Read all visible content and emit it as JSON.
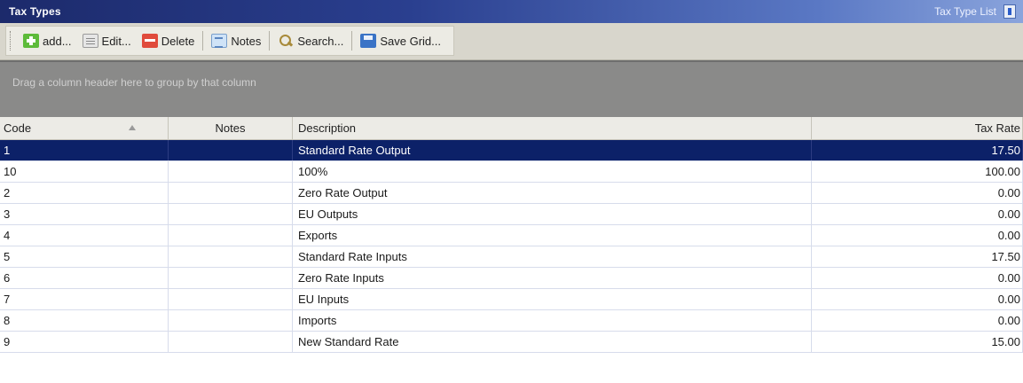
{
  "window": {
    "title": "Tax Types",
    "right_label": "Tax Type List"
  },
  "toolbar": {
    "add_label": "add...",
    "edit_label": "Edit...",
    "delete_label": "Delete",
    "notes_label": "Notes",
    "search_label": "Search...",
    "save_grid_label": "Save Grid..."
  },
  "group_area": {
    "hint": "Drag a column header here to group by that column"
  },
  "grid": {
    "columns": [
      "Code",
      "Notes",
      "Description",
      "Tax Rate"
    ],
    "sort_column": "Code",
    "rows": [
      {
        "code": "1",
        "notes": "",
        "description": "Standard Rate Output",
        "rate": "17.50",
        "selected": true
      },
      {
        "code": "10",
        "notes": "",
        "description": "100%",
        "rate": "100.00"
      },
      {
        "code": "2",
        "notes": "",
        "description": "Zero Rate Output",
        "rate": "0.00"
      },
      {
        "code": "3",
        "notes": "",
        "description": "EU Outputs",
        "rate": "0.00"
      },
      {
        "code": "4",
        "notes": "",
        "description": "Exports",
        "rate": "0.00"
      },
      {
        "code": "5",
        "notes": "",
        "description": "Standard Rate Inputs",
        "rate": "17.50"
      },
      {
        "code": "6",
        "notes": "",
        "description": "Zero Rate Inputs",
        "rate": "0.00"
      },
      {
        "code": "7",
        "notes": "",
        "description": "EU Inputs",
        "rate": "0.00"
      },
      {
        "code": "8",
        "notes": "",
        "description": "Imports",
        "rate": "0.00"
      },
      {
        "code": "9",
        "notes": "",
        "description": "New Standard Rate",
        "rate": "15.00"
      }
    ]
  },
  "colors": {
    "title_bar": "#2a3f8f",
    "selected_row": "#0c2168",
    "group_area": "#8a8a89"
  },
  "icons": [
    "add-icon",
    "edit-icon",
    "delete-icon",
    "notes-icon",
    "search-icon",
    "save-icon",
    "pin-icon",
    "sort-ascending-icon"
  ]
}
